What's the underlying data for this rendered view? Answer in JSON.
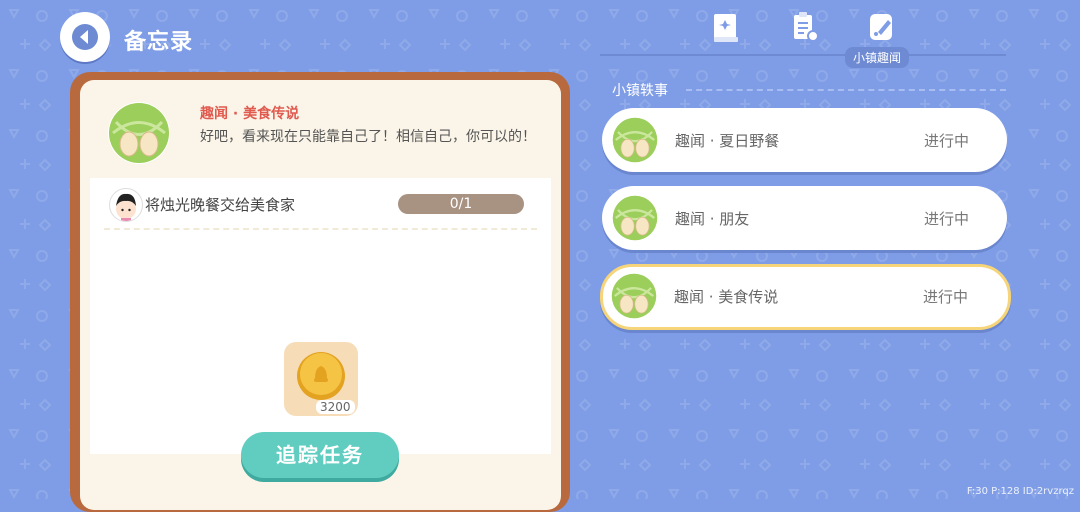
{
  "header": {
    "title": "备忘录",
    "back_icon": "back-arrow-icon"
  },
  "tabs": [
    {
      "icon": "memo-book-icon",
      "active": false
    },
    {
      "icon": "checklist-icon",
      "active": false
    },
    {
      "icon": "fun-news-icon",
      "active": true,
      "label": "小镇趣闻"
    }
  ],
  "section": {
    "label": "小镇轶事"
  },
  "quests": [
    {
      "title": "趣闻 · 夏日野餐",
      "status": "进行中",
      "selected": false
    },
    {
      "title": "趣闻 · 朋友",
      "status": "进行中",
      "selected": false
    },
    {
      "title": "趣闻 · 美食传说",
      "status": "进行中",
      "selected": true
    }
  ],
  "detail": {
    "name": "趣闻 · 美食传说",
    "description": "好吧，看来现在只能靠自己了！相信自己，你可以的！",
    "task": {
      "text": "将烛光晚餐交给美食家",
      "progress": "0/1"
    },
    "reward": {
      "icon": "gold-coin-icon",
      "count": "3200"
    },
    "track_button": "追踪任务"
  },
  "debug_info": "F:30   P:128   ID:2rvzrqz",
  "colors": {
    "background": "#7f9de6",
    "frame": "#b86a3e",
    "button": "#60cdc0",
    "quest_title": "#e05a4f"
  }
}
